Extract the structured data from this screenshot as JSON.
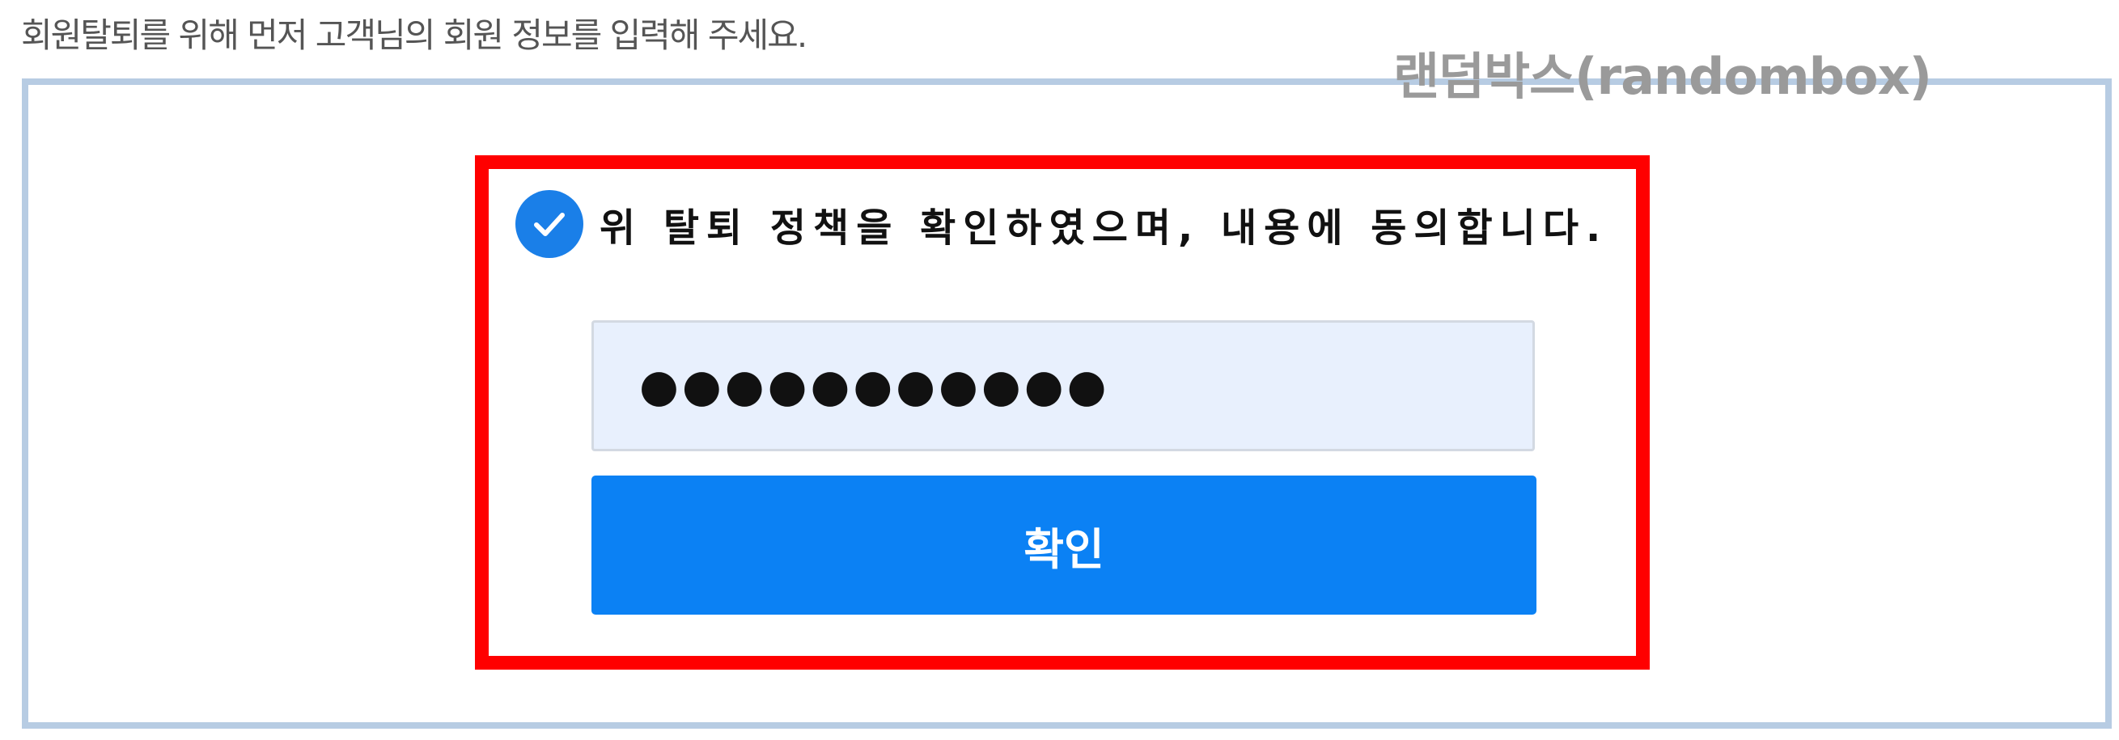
{
  "instruction": "회원탈퇴를 위해 먼저 고객님의 회원 정보를 입력해 주세요.",
  "watermark": "랜덤박스(randombox)",
  "agreement": {
    "checked": true,
    "label": "위 탈퇴 정책을 확인하였으며, 내용에 동의합니다.",
    "icon": "check-circle-icon"
  },
  "password": {
    "value": "●●●●●●●●●●●"
  },
  "confirm_button": {
    "label": "확인"
  },
  "colors": {
    "accent": "#0b81f4",
    "check": "#1a7fe8",
    "highlight": "#ff0000",
    "outer_border": "#b7cce3",
    "input_bg": "#e8f0fd"
  }
}
